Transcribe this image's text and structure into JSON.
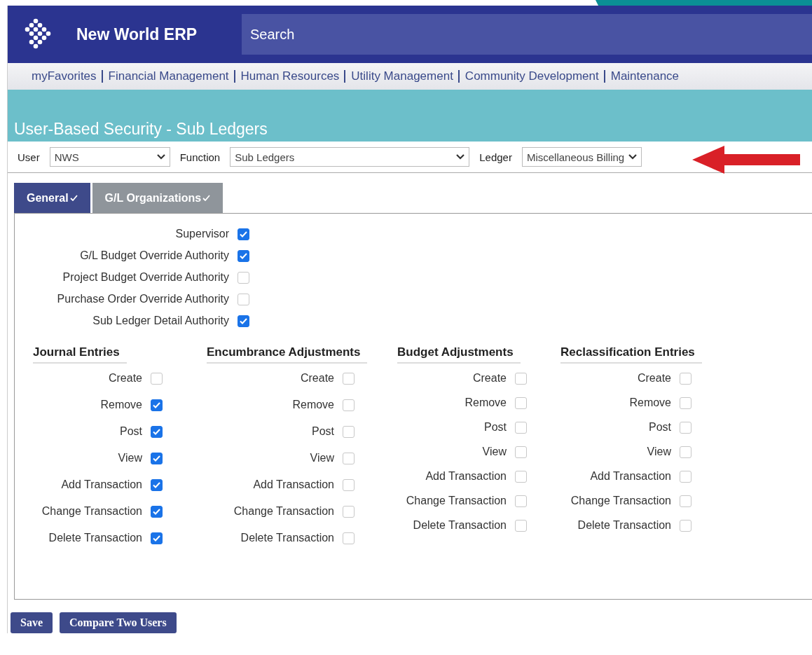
{
  "header": {
    "app_name": "New World ERP",
    "search": {
      "placeholder": "Search"
    }
  },
  "nav": [
    "myFavorites",
    "Financial Management",
    "Human Resources",
    "Utility Management",
    "Community Development",
    "Maintenance"
  ],
  "page_title": "User-Based Security - Sub Ledgers",
  "filters": [
    {
      "label": "User",
      "value": "NWS"
    },
    {
      "label": "Function",
      "value": "Sub Ledgers"
    },
    {
      "label": "Ledger",
      "value": "Miscellaneous Billing"
    }
  ],
  "tabs": [
    {
      "label": "General",
      "selected": true
    },
    {
      "label": "G/L Organizations",
      "selected": false
    }
  ],
  "general": [
    {
      "label": "Supervisor",
      "checked": true
    },
    {
      "label": "G/L Budget Override Authority",
      "checked": true
    },
    {
      "label": "Project Budget Override Authority",
      "checked": false
    },
    {
      "label": "Purchase Order Override Authority",
      "checked": false
    },
    {
      "label": "Sub Ledger Detail Authority",
      "checked": true
    }
  ],
  "groups": [
    {
      "title": "Journal Entries",
      "items": [
        {
          "label": "Create",
          "checked": false
        },
        {
          "label": "Remove",
          "checked": true
        },
        {
          "label": "Post",
          "checked": true
        },
        {
          "label": "View",
          "checked": true
        },
        {
          "label": "Add Transaction",
          "checked": true
        },
        {
          "label": "Change Transaction",
          "checked": true
        },
        {
          "label": "Delete Transaction",
          "checked": true
        }
      ]
    },
    {
      "title": "Encumbrance Adjustments",
      "items": [
        {
          "label": "Create",
          "checked": false
        },
        {
          "label": "Remove",
          "checked": false
        },
        {
          "label": "Post",
          "checked": false
        },
        {
          "label": "View",
          "checked": false
        },
        {
          "label": "Add Transaction",
          "checked": false
        },
        {
          "label": "Change Transaction",
          "checked": false
        },
        {
          "label": "Delete Transaction",
          "checked": false
        }
      ]
    },
    {
      "title": "Budget Adjustments",
      "items": [
        {
          "label": "Create",
          "checked": false
        },
        {
          "label": "Remove",
          "checked": false
        },
        {
          "label": "Post",
          "checked": false
        },
        {
          "label": "View",
          "checked": false
        },
        {
          "label": "Add Transaction",
          "checked": false
        },
        {
          "label": "Change Transaction",
          "checked": false
        },
        {
          "label": "Delete Transaction",
          "checked": false
        }
      ]
    },
    {
      "title": "Reclassification Entries",
      "items": [
        {
          "label": "Create",
          "checked": false
        },
        {
          "label": "Remove",
          "checked": false
        },
        {
          "label": "Post",
          "checked": false
        },
        {
          "label": "View",
          "checked": false
        },
        {
          "label": "Add Transaction",
          "checked": false
        },
        {
          "label": "Change Transaction",
          "checked": false
        },
        {
          "label": "Delete Transaction",
          "checked": false
        }
      ]
    }
  ],
  "buttons": [
    "Save",
    "Compare Two Users"
  ]
}
